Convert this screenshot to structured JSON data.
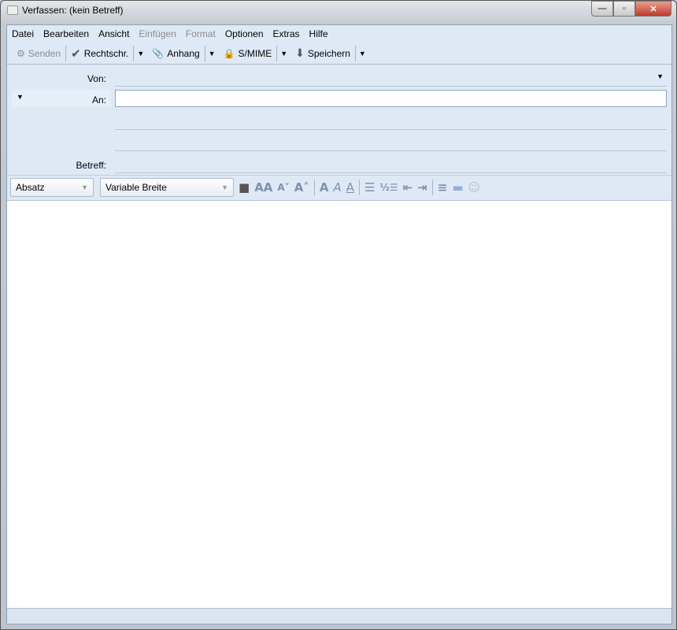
{
  "window": {
    "title": "Verfassen: (kein Betreff)",
    "minimize": "—",
    "maximize": "▫",
    "close": "✕"
  },
  "menu": [
    {
      "label": "Datei",
      "enabled": true
    },
    {
      "label": "Bearbeiten",
      "enabled": true
    },
    {
      "label": "Ansicht",
      "enabled": true
    },
    {
      "label": "Einfügen",
      "enabled": false
    },
    {
      "label": "Format",
      "enabled": false
    },
    {
      "label": "Optionen",
      "enabled": true
    },
    {
      "label": "Extras",
      "enabled": true
    },
    {
      "label": "Hilfe",
      "enabled": true
    }
  ],
  "toolbar": {
    "send": "Senden",
    "spell": "Rechtschr.",
    "attach": "Anhang",
    "smime": "S/MIME",
    "save": "Speichern"
  },
  "header": {
    "from_label": "Von:",
    "from_value": "",
    "to_label": "An:",
    "to_value": "",
    "subject_label": "Betreff:",
    "subject_value": ""
  },
  "format": {
    "paragraph": "Absatz",
    "font": "Variable Breite"
  },
  "body": {
    "text": ""
  }
}
